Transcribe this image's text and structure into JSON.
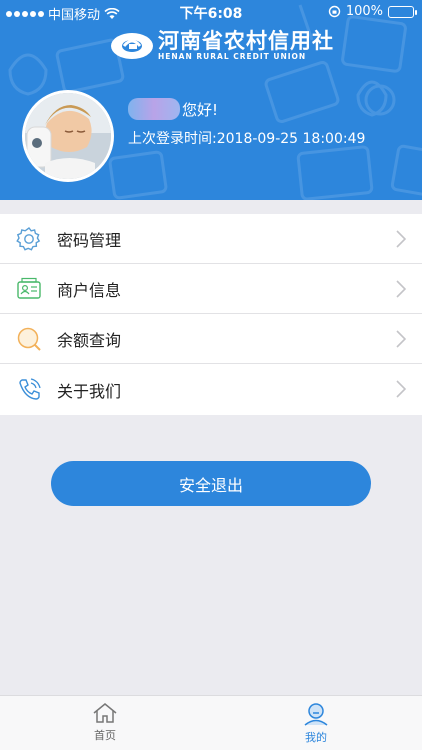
{
  "status_bar": {
    "carrier": "中国移动",
    "time": "下午6:08",
    "battery": "100%"
  },
  "brand": {
    "name": "河南省农村信用社",
    "english": "HENAN RURAL CREDIT UNION"
  },
  "profile": {
    "greeting": "您好!",
    "last_login": "上次登录时间:2018-09-25 18:00:49"
  },
  "menu": {
    "items": [
      {
        "label": "密码管理",
        "icon": "gear-icon"
      },
      {
        "label": "商户信息",
        "icon": "id-card-icon"
      },
      {
        "label": "余额查询",
        "icon": "search-icon"
      },
      {
        "label": "关于我们",
        "icon": "phone-icon"
      }
    ]
  },
  "logout_label": "安全退出",
  "tabs": [
    {
      "label": "首页",
      "icon": "home-icon"
    },
    {
      "label": "我的",
      "icon": "user-icon"
    }
  ],
  "colors": {
    "primary": "#2d86dc",
    "background": "#ebebf0",
    "menu_text": "#222222"
  }
}
